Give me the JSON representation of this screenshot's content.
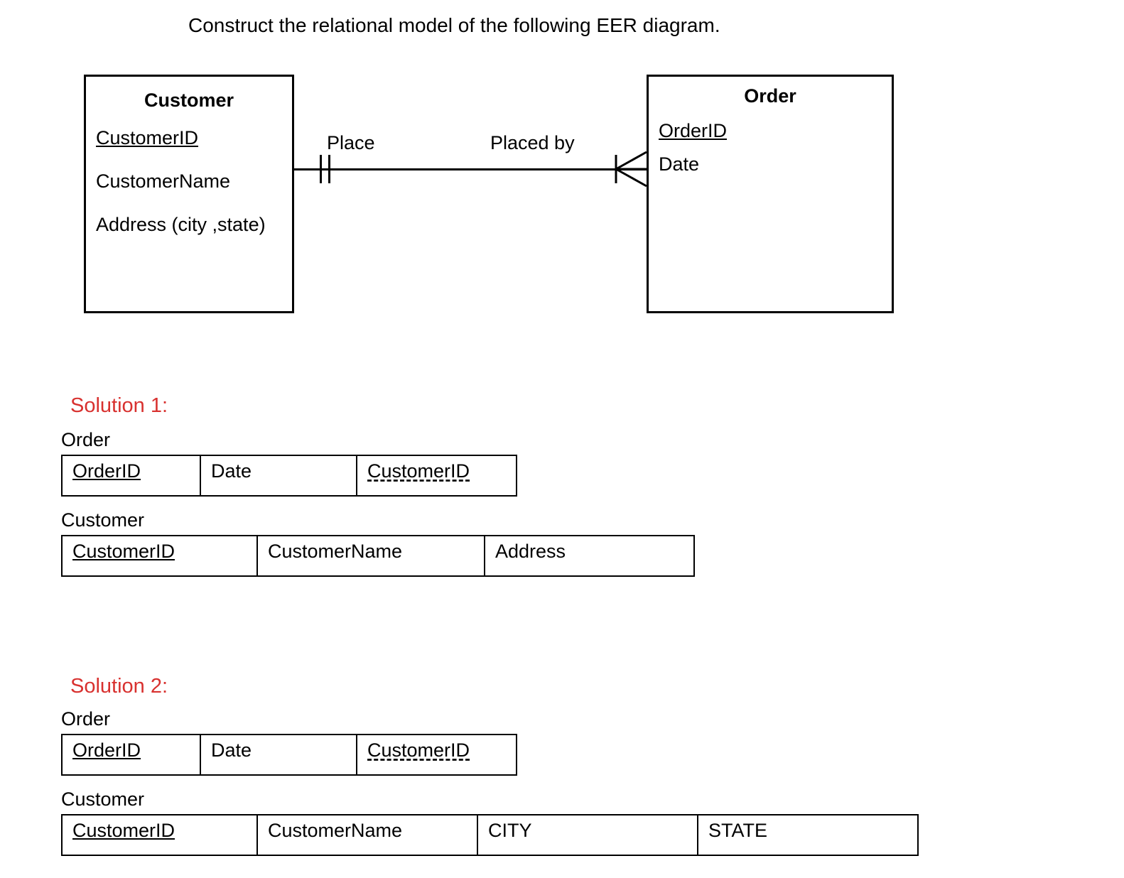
{
  "heading": "Construct the relational model of the following EER diagram.",
  "eer": {
    "customer": {
      "title": "Customer",
      "attrs": [
        "CustomerID",
        "CustomerName",
        "Address (city ,state)"
      ]
    },
    "order": {
      "title": "Order",
      "attrs": [
        "OrderID",
        "Date"
      ]
    },
    "rel": {
      "left": "Place",
      "right": "Placed by"
    }
  },
  "solutions": {
    "s1": {
      "heading": "Solution 1:",
      "order": {
        "name": "Order",
        "cols": [
          "OrderID",
          "Date",
          "CustomerID"
        ]
      },
      "customer": {
        "name": "Customer",
        "cols": [
          "CustomerID",
          "CustomerName",
          "Address"
        ]
      }
    },
    "s2": {
      "heading": "Solution 2:",
      "order": {
        "name": "Order",
        "cols": [
          "OrderID",
          "Date",
          "CustomerID"
        ]
      },
      "customer": {
        "name": "Customer",
        "cols": [
          "CustomerID",
          "CustomerName",
          "CITY",
          "STATE"
        ]
      }
    }
  }
}
